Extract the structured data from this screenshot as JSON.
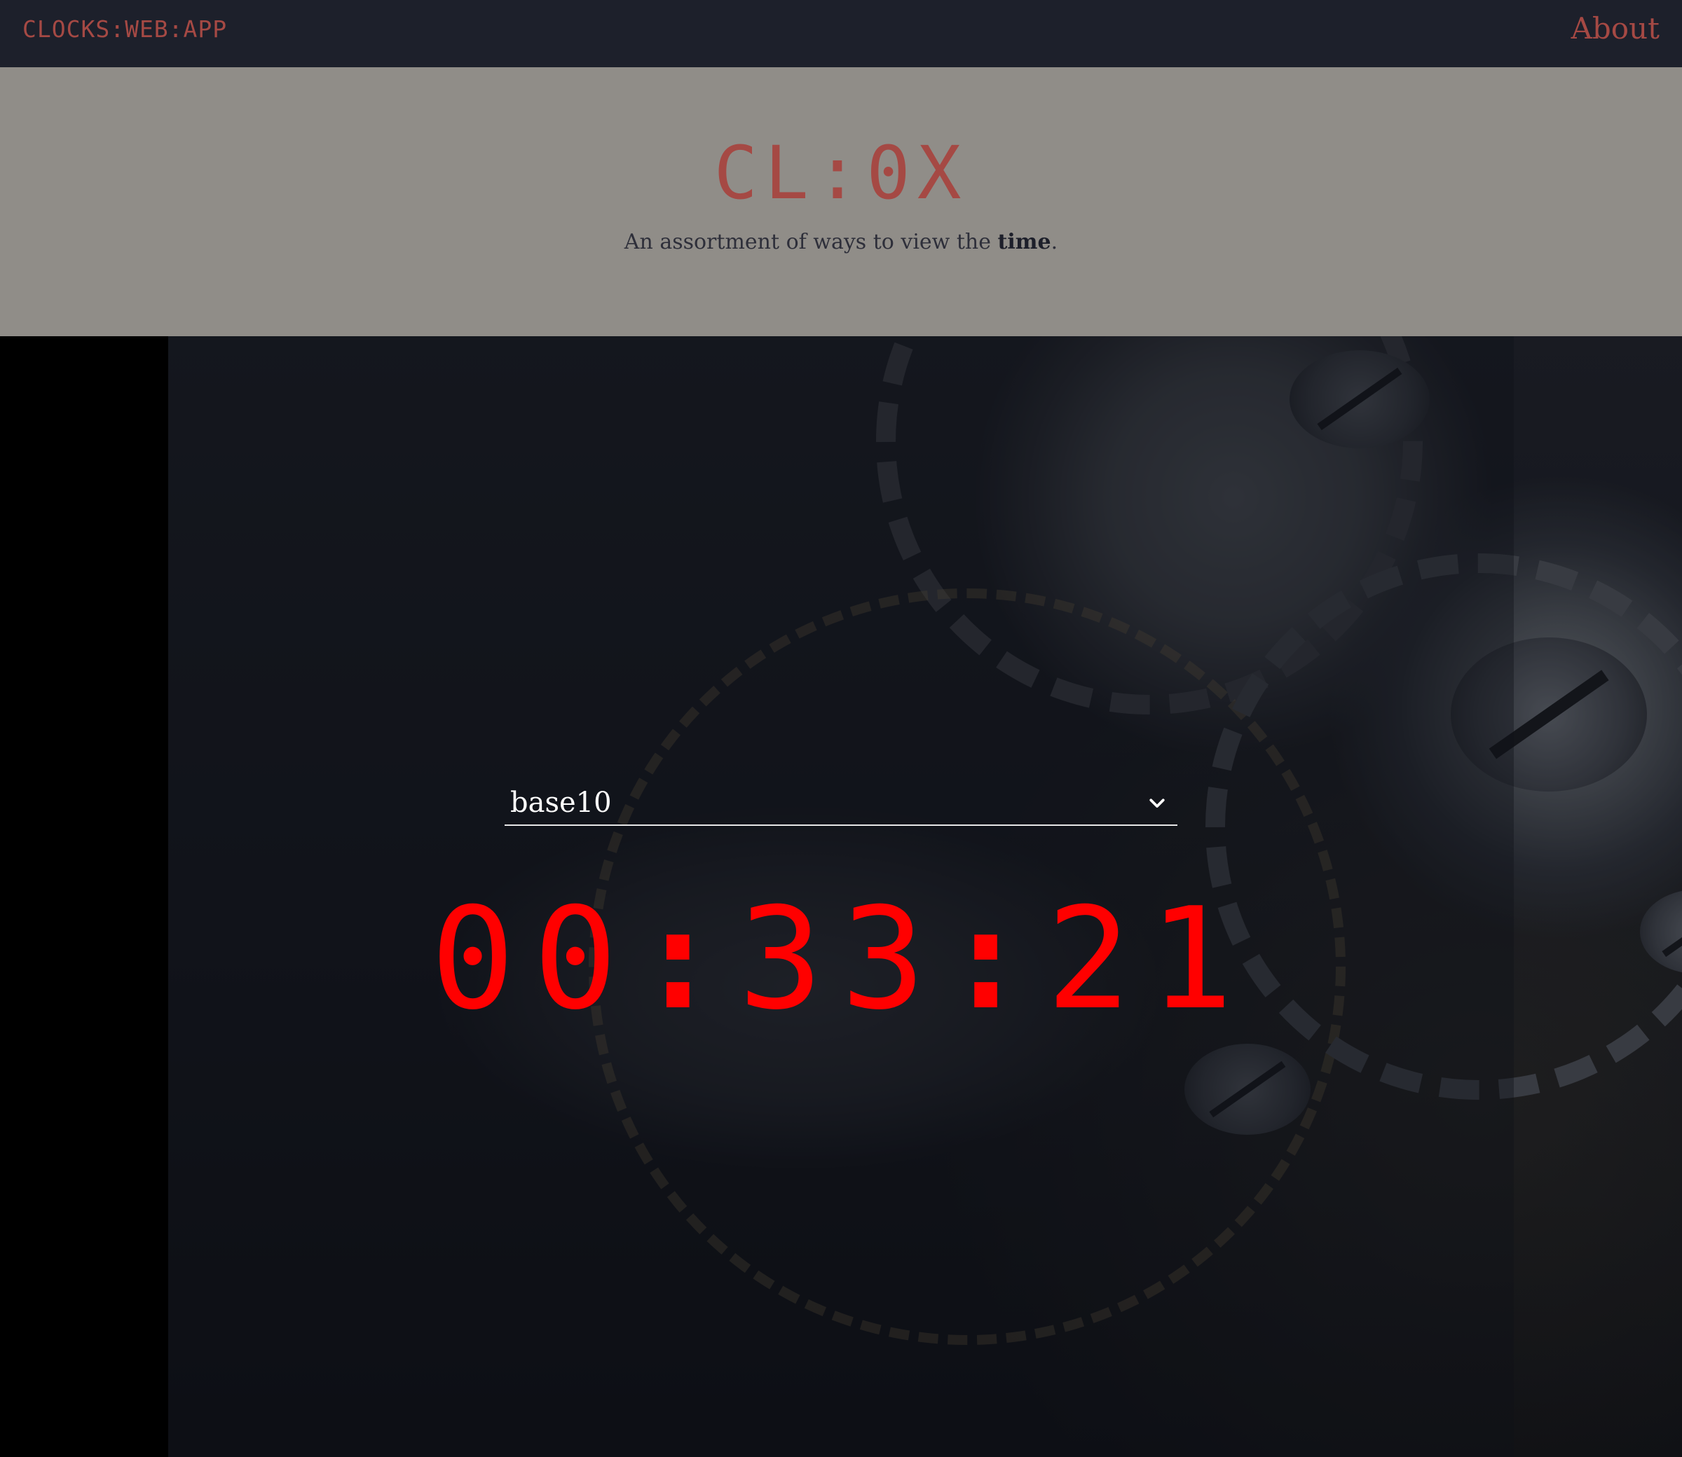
{
  "nav": {
    "brand": "CLOCKS:WEB:APP",
    "about": "About"
  },
  "hero": {
    "title": "CL:0X",
    "subtitle_prefix": "An assortment of ways to view the ",
    "subtitle_bold": "time",
    "subtitle_suffix": "."
  },
  "clock": {
    "format_selected": "base10",
    "hours": "00",
    "minutes": "33",
    "seconds": "21",
    "separator": ":"
  },
  "icons": {
    "select_chevron": "chevron-down-icon"
  },
  "colors": {
    "navbar_bg": "#1d202b",
    "brand_accent": "#a54944",
    "hero_bg": "#908d88",
    "clock_digits": "#ff0000",
    "select_text": "#ffffff"
  }
}
